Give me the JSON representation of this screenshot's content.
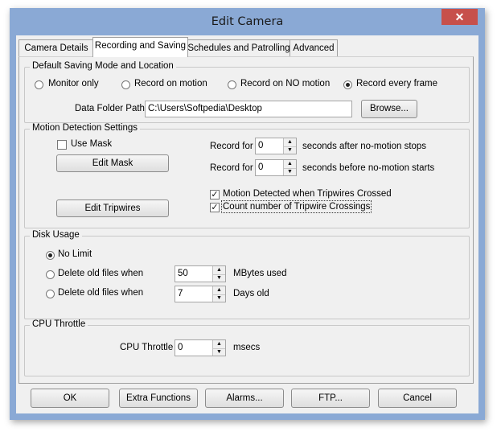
{
  "window": {
    "title": "Edit Camera",
    "close_glyph": "✕"
  },
  "tabs": [
    {
      "label": "Camera Details",
      "active": false
    },
    {
      "label": "Recording and Saving",
      "active": true
    },
    {
      "label": "Schedules and Patrolling",
      "active": false
    },
    {
      "label": "Advanced",
      "active": false
    }
  ],
  "default_saving": {
    "legend": "Default Saving Mode and Location",
    "modes": [
      {
        "label": "Monitor only",
        "selected": false
      },
      {
        "label": "Record on motion",
        "selected": false
      },
      {
        "label": "Record on NO motion",
        "selected": false
      },
      {
        "label": "Record every frame",
        "selected": true
      }
    ],
    "folder_label": "Data Folder Path",
    "folder_value": "C:\\Users\\Softpedia\\Desktop",
    "browse_label": "Browse..."
  },
  "motion": {
    "legend": "Motion Detection Settings",
    "use_mask_label": "Use Mask",
    "use_mask_checked": false,
    "edit_mask_label": "Edit Mask",
    "edit_tripwires_label": "Edit Tripwires",
    "record_for_label": "Record for",
    "after_value": "0",
    "after_suffix": "seconds after no-motion stops",
    "before_value": "0",
    "before_suffix": "seconds before no-motion starts",
    "tripwire_crossed_label": "Motion Detected when Tripwires Crossed",
    "tripwire_crossed_checked": true,
    "count_crossings_label": "Count number of Tripwire Crossings",
    "count_crossings_checked": true
  },
  "disk": {
    "legend": "Disk Usage",
    "no_limit_label": "No Limit",
    "delete_mb_label": "Delete old files when",
    "mb_value": "50",
    "mb_suffix": "MBytes used",
    "delete_days_label": "Delete old files when",
    "days_value": "7",
    "days_suffix": "Days old",
    "selected": "no_limit"
  },
  "cpu": {
    "legend": "CPU Throttle",
    "label": "CPU Throttle",
    "value": "0",
    "suffix": "msecs"
  },
  "buttons": {
    "ok": "OK",
    "extra": "Extra Functions",
    "alarms": "Alarms...",
    "ftp": "FTP...",
    "cancel": "Cancel"
  },
  "icons": {
    "check": "✓",
    "spin_up": "▲",
    "spin_down": "▼"
  },
  "colors": {
    "frame": "#8aa9d5",
    "close": "#c7504b",
    "panel": "#f0f0f0"
  }
}
